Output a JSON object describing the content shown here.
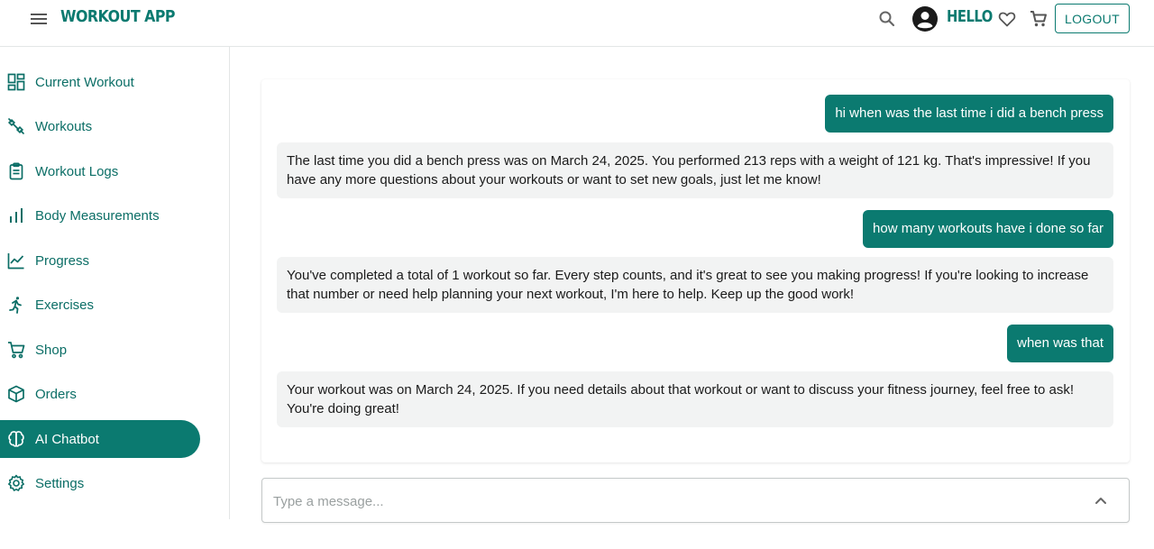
{
  "header": {
    "brand": "WORKOUT APP",
    "greeting": "HELLO",
    "logout_label": "LOGOUT",
    "icons": [
      "menu-icon",
      "search-icon",
      "account-icon",
      "heart-icon",
      "cart-icon"
    ]
  },
  "sidebar": {
    "items": [
      {
        "label": "Current Workout",
        "icon": "dashboard-icon"
      },
      {
        "label": "Workouts",
        "icon": "fitness-icon"
      },
      {
        "label": "Workout Logs",
        "icon": "clipboard-icon"
      },
      {
        "label": "Body Measurements",
        "icon": "bar-chart-icon"
      },
      {
        "label": "Progress",
        "icon": "line-chart-icon"
      },
      {
        "label": "Exercises",
        "icon": "running-icon"
      },
      {
        "label": "Shop",
        "icon": "cart-icon"
      },
      {
        "label": "Orders",
        "icon": "package-icon"
      },
      {
        "label": "AI Chatbot",
        "icon": "brain-icon",
        "active": true
      },
      {
        "label": "Settings",
        "icon": "gear-icon"
      }
    ]
  },
  "chat": {
    "messages": [
      {
        "role": "user",
        "text": "hi when was the last time i did a bench press"
      },
      {
        "role": "bot",
        "text": "The last time you did a bench press was on March 24, 2025. You performed 213 reps with a weight of 121 kg. That's impressive! If you have any more questions about your workouts or want to set new goals, just let me know!"
      },
      {
        "role": "user",
        "text": "how many workouts have i done so far"
      },
      {
        "role": "bot",
        "text": "You've completed a total of 1 workout so far. Every step counts, and it's great to see you making progress! If you're looking to increase that number or need help planning your next workout, I'm here to help. Keep up the good work!"
      },
      {
        "role": "user",
        "text": "when was that"
      },
      {
        "role": "bot",
        "text": "Your workout was on March 24, 2025. If you need details about that workout or want to discuss your fitness journey, feel free to ask! You're doing great!"
      }
    ]
  },
  "input": {
    "placeholder": "Type a message...",
    "value": ""
  },
  "colors": {
    "accent": "#0b7a70",
    "bot_bubble": "#f2f3f3",
    "user_bubble": "#0b7a70"
  }
}
